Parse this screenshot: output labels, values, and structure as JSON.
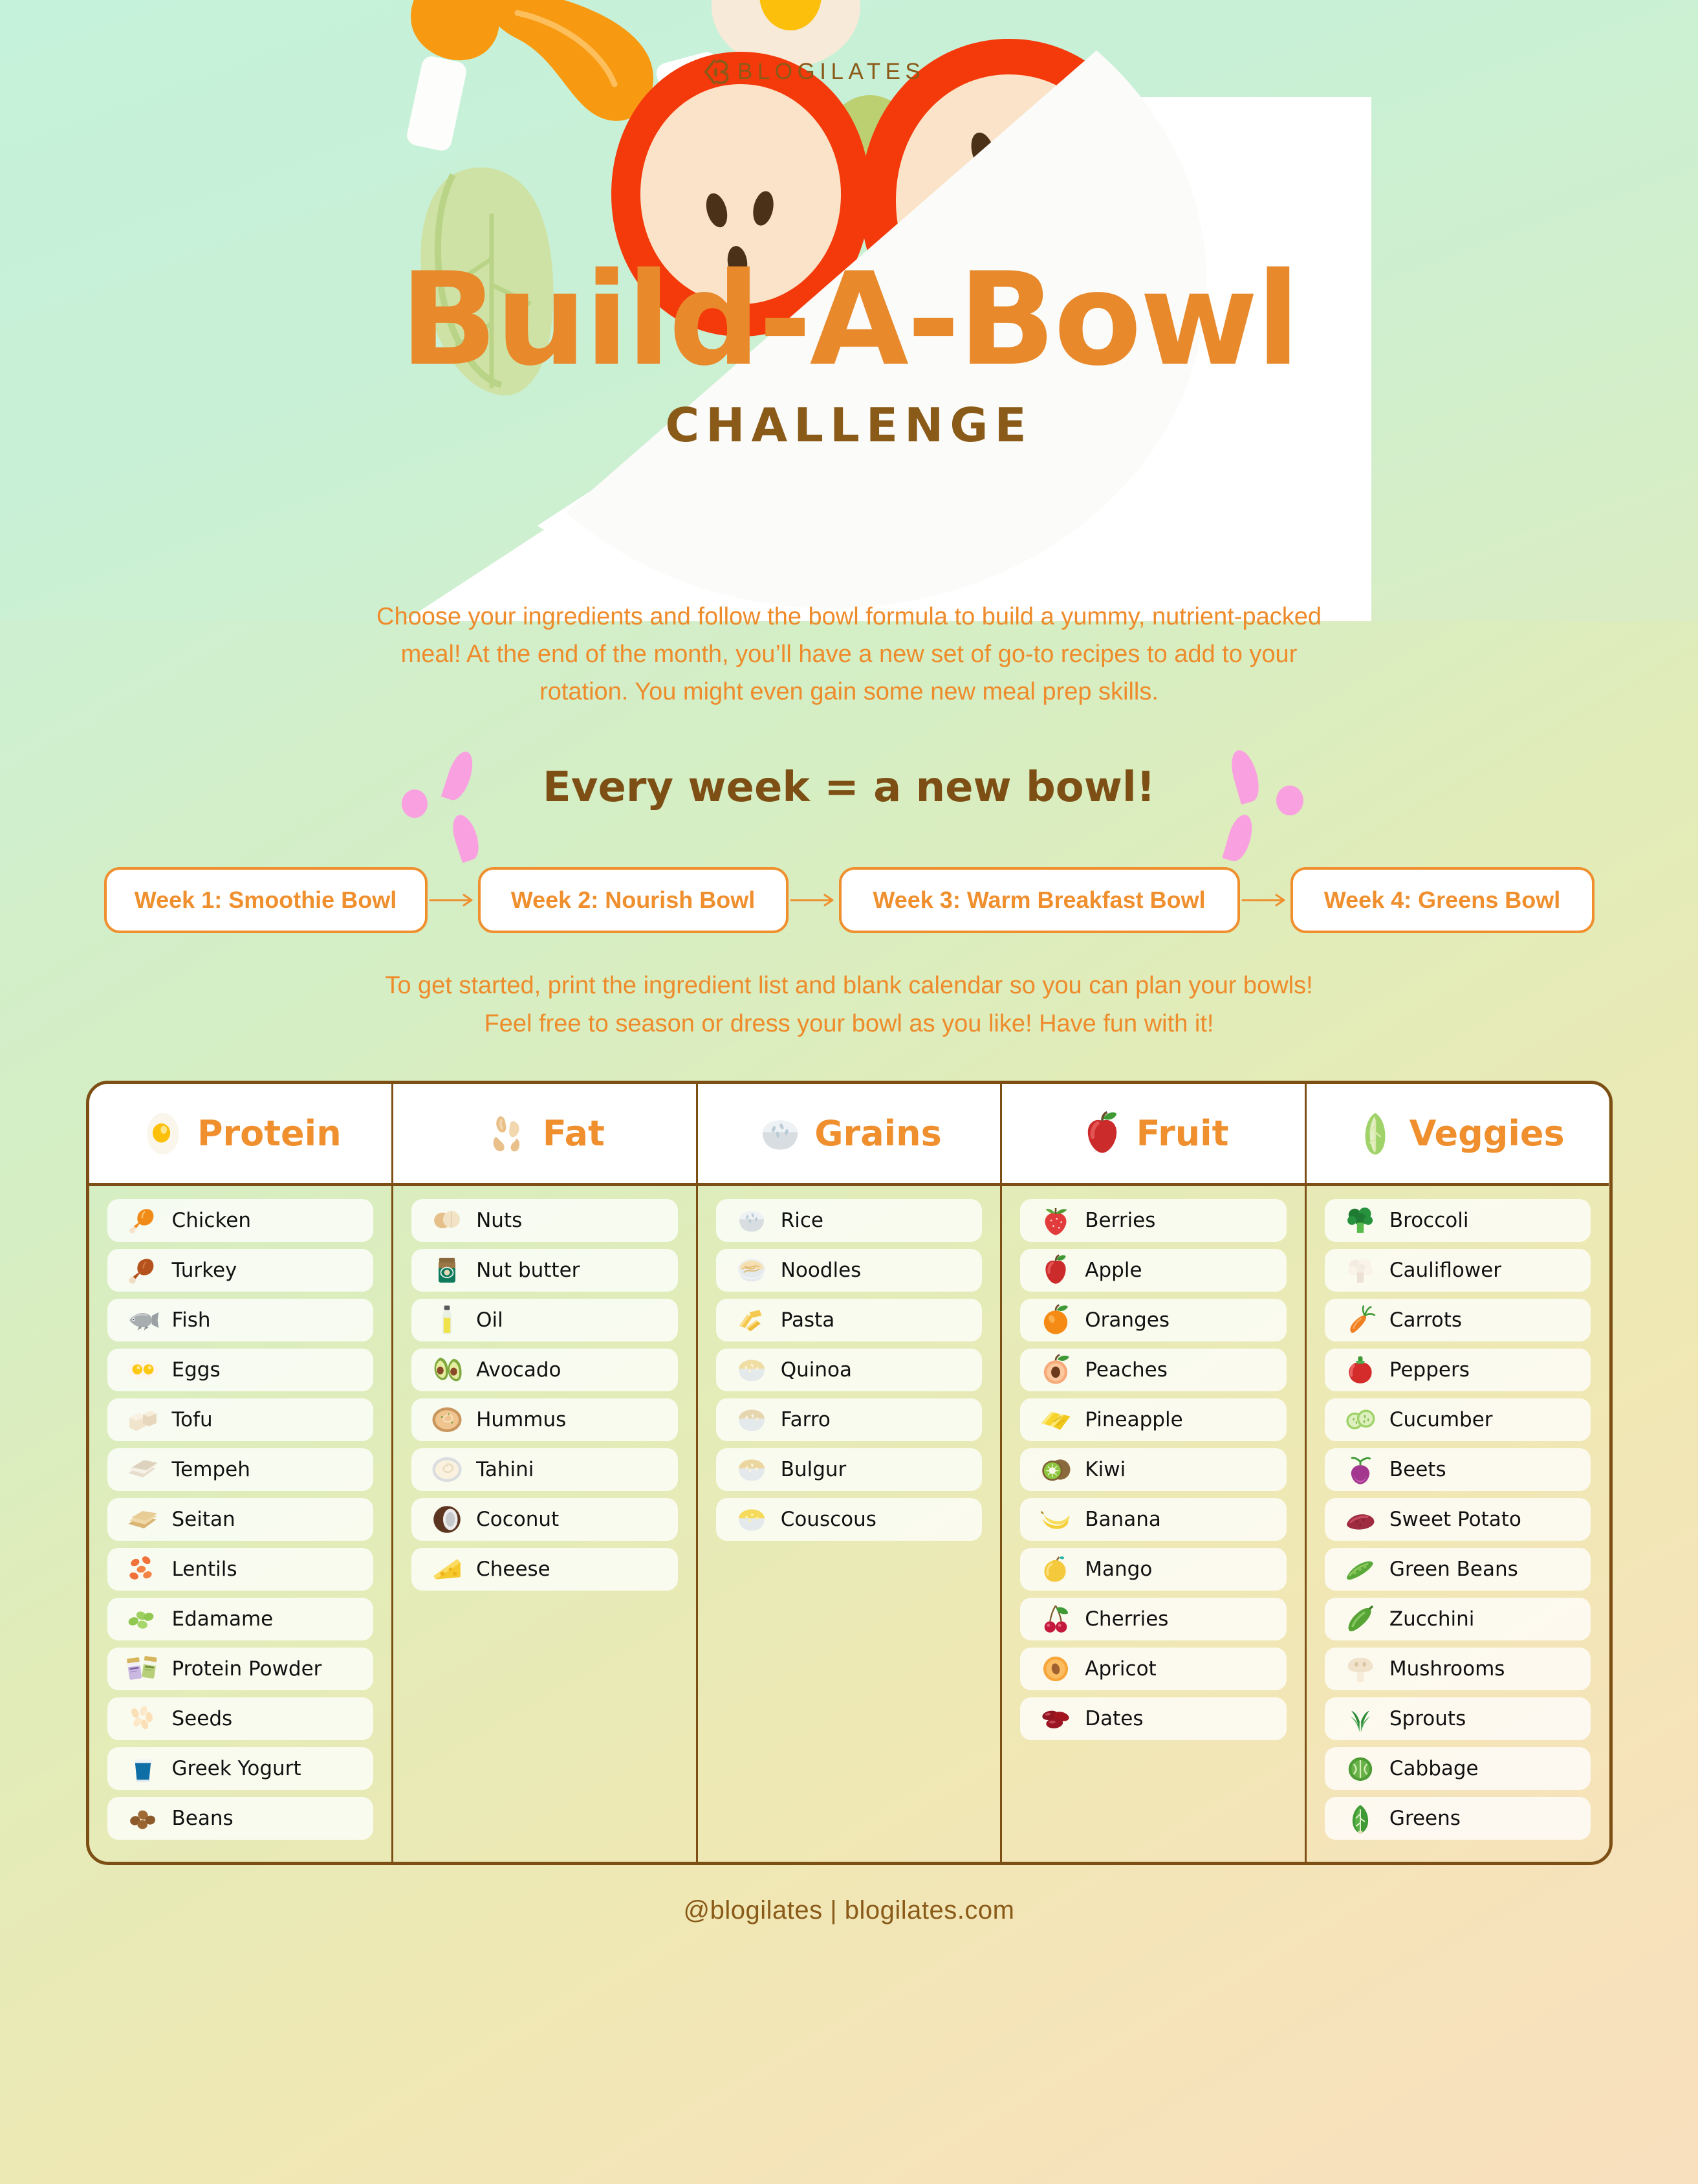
{
  "brand": {
    "logo_text": "BLOGILATES",
    "logo_icon": "blogilates-logo-icon"
  },
  "hero": {
    "title": "Build-A-Bowl",
    "subtitle": "CHALLENGE"
  },
  "intro": {
    "line1": "Choose your ingredients and follow the bowl formula to build a yummy, nutrient-packed",
    "line2": "meal! At the end of the month, you’ll have a new set of go-to recipes to add to your",
    "line3": "rotation. You might even gain some new meal prep skills."
  },
  "week_banner": {
    "text": "Every week = a new bowl!"
  },
  "weeks": [
    {
      "label": "Week 1: Smoothie Bowl"
    },
    {
      "label": "Week 2: Nourish Bowl"
    },
    {
      "label": "Week 3: Warm Breakfast Bowl"
    },
    {
      "label": "Week 4: Greens Bowl"
    }
  ],
  "print_note": {
    "line1": "To get started, print the ingredient list and blank calendar so you can plan your bowls!",
    "line2": "Feel free to season or dress your bowl as you like! Have fun with it!"
  },
  "table": {
    "columns": [
      {
        "header": "Protein",
        "header_icon": "fried-egg-icon",
        "items": [
          {
            "label": "Chicken",
            "icon": "chicken-leg-icon"
          },
          {
            "label": "Turkey",
            "icon": "turkey-leg-icon"
          },
          {
            "label": "Fish",
            "icon": "fish-icon"
          },
          {
            "label": "Eggs",
            "icon": "two-eggs-icon"
          },
          {
            "label": "Tofu",
            "icon": "tofu-cubes-icon"
          },
          {
            "label": "Tempeh",
            "icon": "tempeh-slices-icon"
          },
          {
            "label": "Seitan",
            "icon": "seitan-slices-icon"
          },
          {
            "label": "Lentils",
            "icon": "lentils-icon"
          },
          {
            "label": "Edamame",
            "icon": "edamame-icon"
          },
          {
            "label": "Protein Powder",
            "icon": "protein-powder-tubs-icon"
          },
          {
            "label": "Seeds",
            "icon": "seeds-icon"
          },
          {
            "label": "Greek Yogurt",
            "icon": "yogurt-cup-icon"
          },
          {
            "label": "Beans",
            "icon": "beans-icon"
          }
        ]
      },
      {
        "header": "Fat",
        "header_icon": "cashews-icon",
        "items": [
          {
            "label": "Nuts",
            "icon": "nuts-icon"
          },
          {
            "label": "Nut butter",
            "icon": "nut-butter-jar-icon"
          },
          {
            "label": "Oil",
            "icon": "oil-bottle-icon"
          },
          {
            "label": "Avocado",
            "icon": "avocado-icon"
          },
          {
            "label": "Hummus",
            "icon": "hummus-bowl-icon"
          },
          {
            "label": "Tahini",
            "icon": "tahini-bowl-icon"
          },
          {
            "label": "Coconut",
            "icon": "coconut-icon"
          },
          {
            "label": "Cheese",
            "icon": "cheese-wedge-icon"
          }
        ]
      },
      {
        "header": "Grains",
        "header_icon": "rice-bowl-icon",
        "items": [
          {
            "label": "Rice",
            "icon": "rice-bowl-icon"
          },
          {
            "label": "Noodles",
            "icon": "noodles-bowl-icon"
          },
          {
            "label": "Pasta",
            "icon": "penne-pasta-icon"
          },
          {
            "label": "Quinoa",
            "icon": "quinoa-bowl-icon"
          },
          {
            "label": "Farro",
            "icon": "farro-bowl-icon"
          },
          {
            "label": "Bulgur",
            "icon": "bulgur-bowl-icon"
          },
          {
            "label": "Couscous",
            "icon": "couscous-bowl-icon"
          }
        ]
      },
      {
        "header": "Fruit",
        "header_icon": "apple-icon",
        "items": [
          {
            "label": "Berries",
            "icon": "strawberry-icon"
          },
          {
            "label": "Apple",
            "icon": "apple-icon"
          },
          {
            "label": "Oranges",
            "icon": "orange-icon"
          },
          {
            "label": "Peaches",
            "icon": "peach-half-icon"
          },
          {
            "label": "Pineapple",
            "icon": "pineapple-slices-icon"
          },
          {
            "label": "Kiwi",
            "icon": "kiwi-icon"
          },
          {
            "label": "Banana",
            "icon": "banana-icon"
          },
          {
            "label": "Mango",
            "icon": "mango-icon"
          },
          {
            "label": "Cherries",
            "icon": "cherries-icon"
          },
          {
            "label": "Apricot",
            "icon": "apricot-half-icon"
          },
          {
            "label": "Dates",
            "icon": "dates-icon"
          }
        ]
      },
      {
        "header": "Veggies",
        "header_icon": "romaine-leaf-icon",
        "items": [
          {
            "label": "Broccoli",
            "icon": "broccoli-icon"
          },
          {
            "label": "Cauliflower",
            "icon": "cauliflower-icon"
          },
          {
            "label": "Carrots",
            "icon": "carrot-icon"
          },
          {
            "label": "Peppers",
            "icon": "bell-pepper-icon"
          },
          {
            "label": "Cucumber",
            "icon": "cucumber-slices-icon"
          },
          {
            "label": "Beets",
            "icon": "beet-icon"
          },
          {
            "label": "Sweet Potato",
            "icon": "sweet-potato-icon"
          },
          {
            "label": "Green Beans",
            "icon": "green-beans-icon"
          },
          {
            "label": "Zucchini",
            "icon": "zucchini-icon"
          },
          {
            "label": "Mushrooms",
            "icon": "mushroom-icon"
          },
          {
            "label": "Sprouts",
            "icon": "sprouts-icon"
          },
          {
            "label": "Cabbage",
            "icon": "cabbage-icon"
          },
          {
            "label": "Greens",
            "icon": "greens-leaf-icon"
          }
        ]
      }
    ]
  },
  "footer": {
    "text": "@blogilates | blogilates.com"
  },
  "colors": {
    "orange": "#ef8f2e",
    "brown": "#7d4f15",
    "red": "#f4390a",
    "pink": "#f9a0e0",
    "green_bg": "#c5f2da"
  }
}
